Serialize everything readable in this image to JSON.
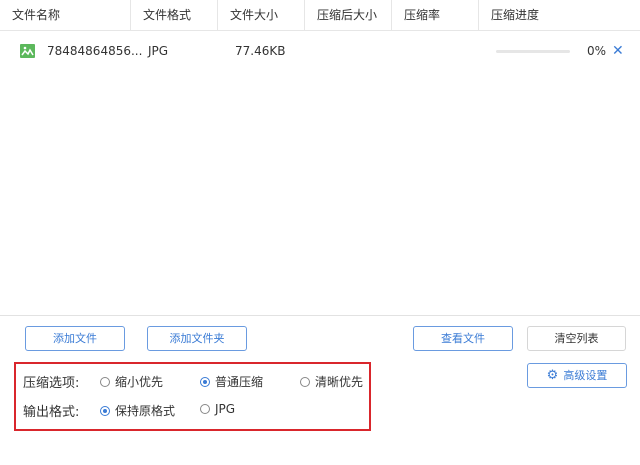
{
  "table": {
    "headers": [
      "文件名称",
      "文件格式",
      "文件大小",
      "压缩后大小",
      "压缩率",
      "压缩进度"
    ],
    "rows": [
      {
        "name": "78484864856...",
        "format": "JPG",
        "size": "77.46KB",
        "compressed_size": "",
        "ratio": "",
        "progress_percent": 0,
        "progress_text": "0%",
        "remove": "✕"
      }
    ]
  },
  "buttons": {
    "add_file": "添加文件",
    "add_folder": "添加文件夹",
    "view_files": "查看文件",
    "clear_list": "清空列表",
    "advanced": "高级设置"
  },
  "options": {
    "compress_label": "压缩选项:",
    "compress_options": [
      "缩小优先",
      "普通压缩",
      "清晰优先"
    ],
    "compress_selected": "普通压缩",
    "format_label": "输出格式:",
    "format_options": [
      "保持原格式",
      "JPG"
    ],
    "format_selected": "保持原格式"
  },
  "colors": {
    "accent": "#3a7bd5",
    "highlight_border": "#d9262c",
    "icon_green": "#5cb85c"
  }
}
